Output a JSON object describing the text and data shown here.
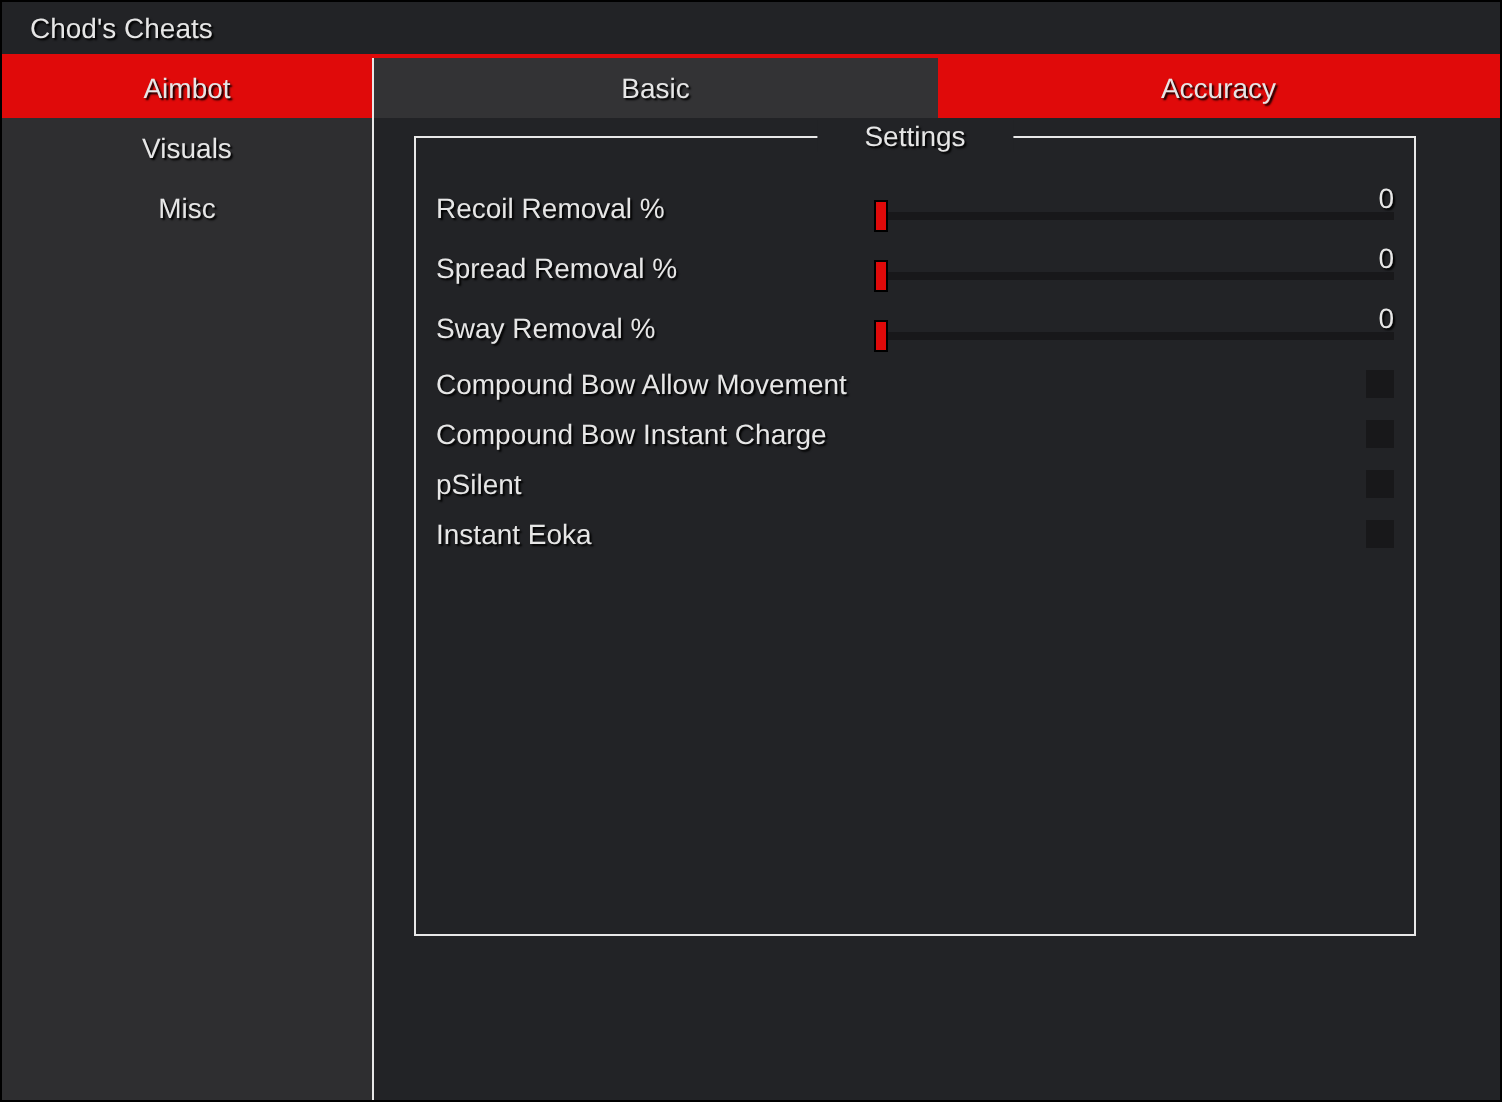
{
  "window": {
    "title": "Chod's Cheats"
  },
  "sidebar": {
    "items": [
      {
        "label": "Aimbot",
        "selected": true
      },
      {
        "label": "Visuals",
        "selected": false
      },
      {
        "label": "Misc",
        "selected": false
      }
    ]
  },
  "tabs": [
    {
      "label": "Basic",
      "selected": false
    },
    {
      "label": "Accuracy",
      "selected": true
    }
  ],
  "group": {
    "title": "Settings",
    "settings": [
      {
        "kind": "slider",
        "label": "Recoil Removal %",
        "level": 0,
        "reading": "0"
      },
      {
        "kind": "slider",
        "label": "Spread Removal %",
        "level": 0,
        "reading": "0"
      },
      {
        "kind": "slider",
        "label": "Sway Removal %",
        "level": 0,
        "reading": "0"
      },
      {
        "kind": "checkbox",
        "label": "Compound Bow Allow Movement",
        "checked": false
      },
      {
        "kind": "checkbox",
        "label": "Compound Bow Instant Charge",
        "checked": false
      },
      {
        "kind": "checkbox",
        "label": "pSilent",
        "checked": false
      },
      {
        "kind": "checkbox",
        "label": "Instant Eoka",
        "checked": false
      }
    ]
  }
}
